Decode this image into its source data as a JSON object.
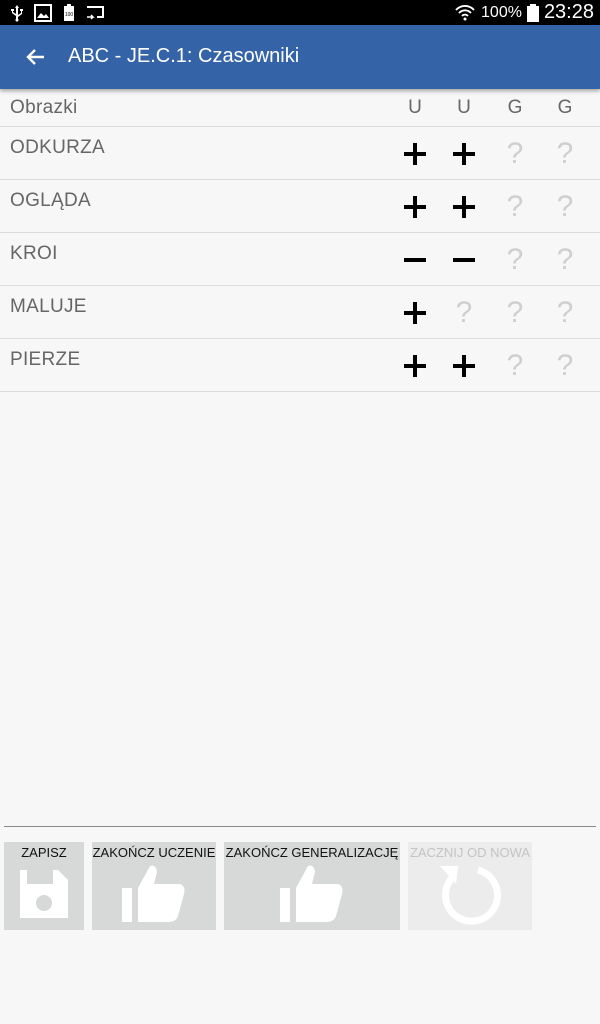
{
  "status_bar": {
    "icons": [
      "usb-icon",
      "image-icon",
      "battery-saver-icon",
      "cast-icon",
      "wifi-icon",
      "battery-icon"
    ],
    "battery_text": "100%",
    "time": "23:28"
  },
  "app_bar": {
    "back_icon": "arrow-back-icon",
    "title": "ABC - JE.C.1: Czasowniki"
  },
  "table": {
    "header": {
      "label": "Obrazki",
      "columns": [
        "U",
        "U",
        "G",
        "G"
      ]
    },
    "rows": [
      {
        "label": "ODKURZA",
        "marks": [
          "+",
          "+",
          "?",
          "?"
        ]
      },
      {
        "label": "OGLĄDA",
        "marks": [
          "+",
          "+",
          "?",
          "?"
        ]
      },
      {
        "label": "KROI",
        "marks": [
          "−",
          "−",
          "?",
          "?"
        ]
      },
      {
        "label": "MALUJE",
        "marks": [
          "+",
          "?",
          "?",
          "?"
        ]
      },
      {
        "label": "PIERZE",
        "marks": [
          "+",
          "+",
          "?",
          "?"
        ]
      }
    ]
  },
  "actions": {
    "save": {
      "label": "ZAPISZ",
      "icon": "floppy-disk-icon"
    },
    "finish_learning": {
      "label": "ZAKOŃCZ UCZENIE",
      "icon": "thumbs-up-icon"
    },
    "finish_generalization": {
      "label": "ZAKOŃCZ GENERALIZACJĘ",
      "icon": "thumbs-up-icon"
    },
    "restart": {
      "label": "ZACZNIJ OD NOWA",
      "icon": "refresh-icon",
      "enabled": false
    }
  },
  "colors": {
    "app_bar": "#3563a8",
    "background": "#f7f7f7",
    "button": "#d7d8d8",
    "icon_white": "#ffffff"
  }
}
